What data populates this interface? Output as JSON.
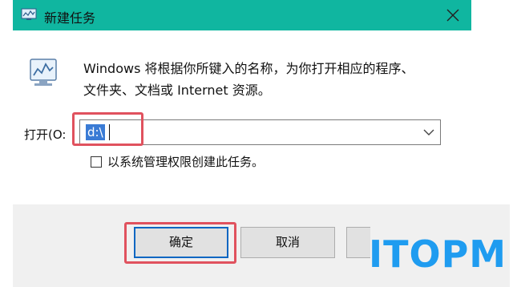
{
  "window": {
    "title": "新建任务"
  },
  "body": {
    "description_line1": "Windows 将根据你所键入的名称，为你打开相应的程序、",
    "description_line2": "文件夹、文档或 Internet 资源。"
  },
  "open_field": {
    "label": "打开(O",
    "label_colon": ":",
    "value": "d:\\"
  },
  "admin_checkbox": {
    "label": "以系统管理权限创建此任务。",
    "checked": false
  },
  "buttons": {
    "ok": "确定",
    "cancel": "取消"
  },
  "watermark": {
    "text": "ITOPM"
  },
  "colors": {
    "titlebar": "#10b6a0",
    "highlight": "#e0525e",
    "selection": "#3a7bd5",
    "watermark": "#1f9cf0"
  }
}
